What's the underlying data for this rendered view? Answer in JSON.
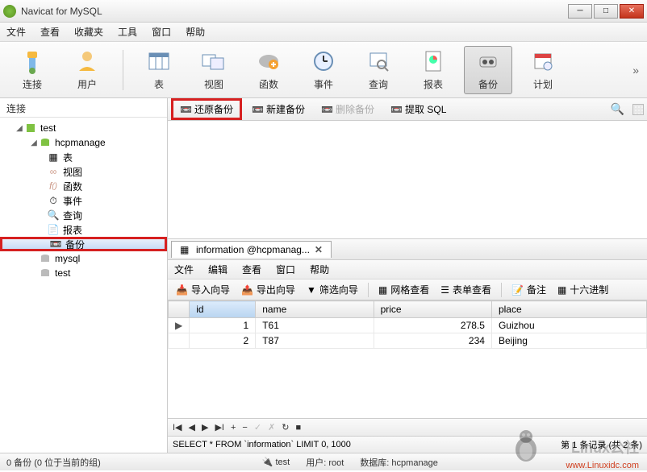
{
  "window": {
    "title": "Navicat for MySQL"
  },
  "menubar": [
    "文件",
    "查看",
    "收藏夹",
    "工具",
    "窗口",
    "帮助"
  ],
  "maintoolbar": {
    "items": [
      {
        "label": "连接"
      },
      {
        "label": "用户"
      },
      {
        "label": "表"
      },
      {
        "label": "视图"
      },
      {
        "label": "函数"
      },
      {
        "label": "事件"
      },
      {
        "label": "查询"
      },
      {
        "label": "报表"
      },
      {
        "label": "备份",
        "selected": true
      },
      {
        "label": "计划"
      }
    ]
  },
  "sidebar": {
    "header": "连接",
    "tree": {
      "root": {
        "label": "test",
        "expanded": true
      },
      "db": {
        "label": "hcpmanage",
        "expanded": true
      },
      "items": [
        {
          "label": "表"
        },
        {
          "label": "视图"
        },
        {
          "label": "函数"
        },
        {
          "label": "事件"
        },
        {
          "label": "查询"
        },
        {
          "label": "报表"
        },
        {
          "label": "备份",
          "selected": true
        }
      ],
      "others": [
        {
          "label": "mysql"
        },
        {
          "label": "test"
        }
      ]
    }
  },
  "subtoolbar": {
    "items": [
      {
        "label": "还原备份",
        "highlight": true
      },
      {
        "label": "新建备份"
      },
      {
        "label": "删除备份",
        "disabled": true
      },
      {
        "label": "提取 SQL"
      }
    ]
  },
  "tab": {
    "title": "information @hcpmanag..."
  },
  "tabmenu": [
    "文件",
    "编辑",
    "查看",
    "窗口",
    "帮助"
  ],
  "tabtoolbar": {
    "g1": [
      {
        "label": "导入向导"
      },
      {
        "label": "导出向导"
      },
      {
        "label": "筛选向导"
      }
    ],
    "g2": [
      {
        "label": "网格查看"
      },
      {
        "label": "表单查看"
      }
    ],
    "g3": [
      {
        "label": "备注"
      },
      {
        "label": "十六进制"
      }
    ]
  },
  "grid": {
    "columns": [
      "id",
      "name",
      "price",
      "place"
    ],
    "rows": [
      {
        "id": "1",
        "name": "T61",
        "price": "278.5",
        "place": "Guizhou",
        "current": true
      },
      {
        "id": "2",
        "name": "T87",
        "price": "234",
        "place": "Beijing"
      }
    ]
  },
  "sql": "SELECT * FROM `information` LIMIT 0, 1000",
  "recinfo": "第 1 条记录 (共 2 条)",
  "statusbar": {
    "count": "0 备份 (0 位于当前的组)",
    "conn": "test",
    "user": "用户: root",
    "db": "数据库: hcpmanage"
  },
  "watermark": {
    "text": "Linux公社",
    "url": "www.Linuxidc.com"
  }
}
